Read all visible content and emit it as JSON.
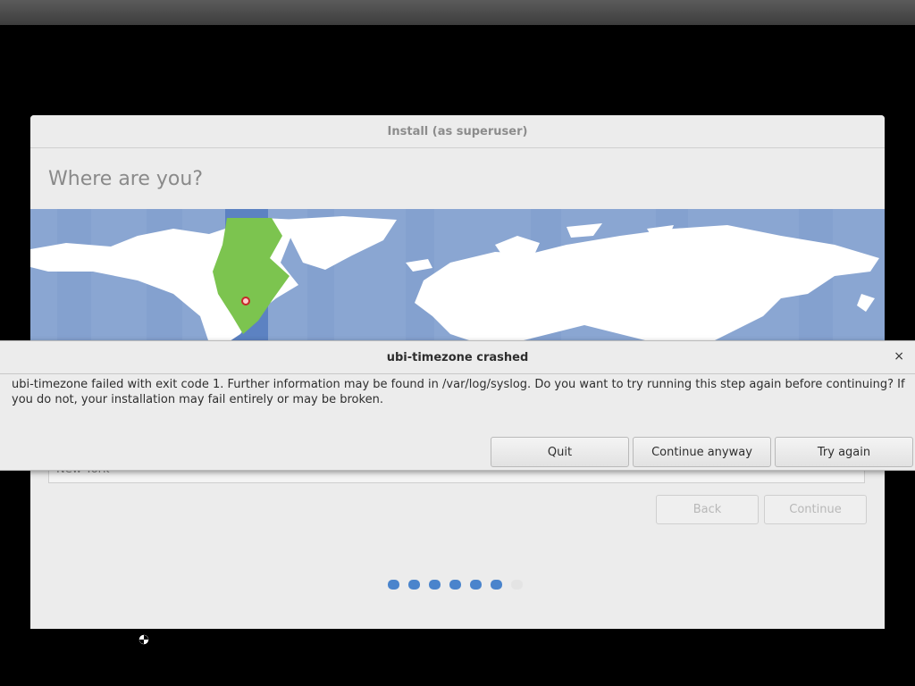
{
  "installer": {
    "title": "Install (as superuser)",
    "heading": "Where are you?",
    "timezone_value": "New York",
    "back_label": "Back",
    "continue_label": "Continue",
    "progress": {
      "total_steps": 7,
      "current_step": 6
    }
  },
  "dialog": {
    "title": "ubi-timezone crashed",
    "close_glyph": "×",
    "message": "ubi-timezone failed with exit code 1. Further information may be found in /var/log/syslog. Do you want to try running this step again before continuing? If you do not, your installation may fail entirely or may be broken.",
    "quit_label": "Quit",
    "continue_anyway_label": "Continue anyway",
    "try_again_label": "Try again"
  },
  "colors": {
    "map_ocean": "#8aa6d2",
    "map_land": "#ffffff",
    "timezone_highlight": "#7cc44f",
    "progress_active": "#4a84cc"
  }
}
